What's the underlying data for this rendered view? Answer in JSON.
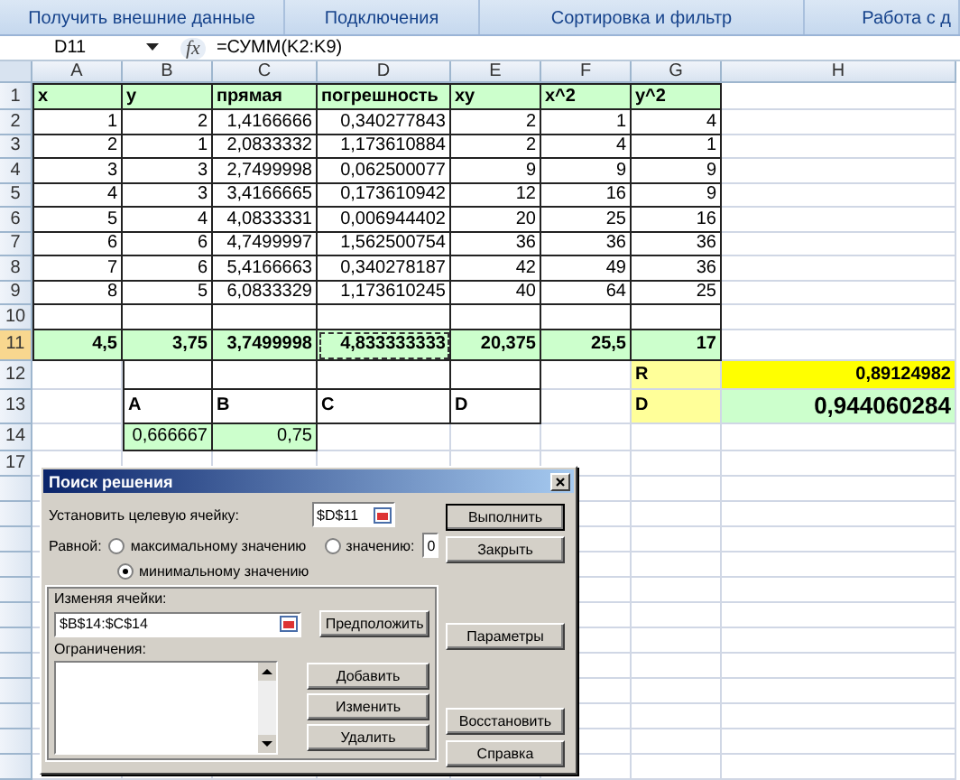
{
  "ribbon_groups": [
    "Получить внешние данные",
    "Подключения",
    "Сортировка и фильтр",
    "Работа с д"
  ],
  "formula_bar": {
    "name_box": "D11",
    "fx_label": "fx",
    "formula": "=СУММ(K2:K9)"
  },
  "sheet": {
    "columns": [
      "A",
      "B",
      "C",
      "D",
      "E",
      "F",
      "G",
      "H"
    ],
    "rows": [
      {
        "number": "1",
        "kind": "header",
        "color": "#ccffcc",
        "cells": [
          "x",
          "y",
          "прямая",
          "погрешность",
          "xy",
          "x^2",
          "y^2",
          null
        ]
      },
      {
        "number": "2",
        "kind": "data",
        "cells": [
          "1",
          "2",
          "1,4166666",
          "0,340277843",
          "2",
          "1",
          "4",
          null
        ]
      },
      {
        "number": "3",
        "kind": "data",
        "cells": [
          "2",
          "1",
          "2,0833332",
          "1,173610884",
          "2",
          "4",
          "1",
          null
        ]
      },
      {
        "number": "4",
        "kind": "data",
        "cells": [
          "3",
          "3",
          "2,7499998",
          "0,062500077",
          "9",
          "9",
          "9",
          null
        ]
      },
      {
        "number": "5",
        "kind": "data",
        "cells": [
          "4",
          "3",
          "3,4166665",
          "0,173610942",
          "12",
          "16",
          "9",
          null
        ]
      },
      {
        "number": "6",
        "kind": "data",
        "cells": [
          "5",
          "4",
          "4,0833331",
          "0,006944402",
          "20",
          "25",
          "16",
          null
        ]
      },
      {
        "number": "7",
        "kind": "data",
        "cells": [
          "6",
          "6",
          "4,7499997",
          "1,562500754",
          "36",
          "36",
          "36",
          null
        ]
      },
      {
        "number": "8",
        "kind": "data",
        "cells": [
          "7",
          "6",
          "5,4166663",
          "0,340278187",
          "42",
          "49",
          "36",
          null
        ]
      },
      {
        "number": "9",
        "kind": "data",
        "cells": [
          "8",
          "5",
          "6,0833329",
          "1,173610245",
          "40",
          "64",
          "25",
          null
        ]
      },
      {
        "number": "10",
        "kind": "data",
        "cells": [
          null,
          null,
          null,
          null,
          null,
          null,
          null,
          null
        ]
      },
      {
        "number": "11",
        "kind": "total",
        "color": "#ccffcc",
        "cells": [
          "4,5",
          "3,75",
          "3,7499998",
          {
            "text": "4,833333333",
            "marquee": true
          },
          "20,375",
          "25,5",
          "17",
          null
        ]
      },
      {
        "number": "12",
        "kind": "result",
        "cells": [
          null,
          null,
          null,
          null,
          null,
          null,
          {
            "text": "R",
            "color": "#ffff99"
          },
          {
            "text": "0,89124982",
            "color": "#ffff00"
          }
        ]
      },
      {
        "number": "13",
        "kind": "labels",
        "cells": [
          null,
          "A",
          "B",
          "C",
          "D",
          null,
          {
            "text": "D",
            "color": "#ffff99"
          },
          {
            "text": "0,944060284",
            "color": "#ccffcc",
            "large": true
          }
        ]
      },
      {
        "number": "14",
        "kind": "values",
        "color": "#ccffcc",
        "cells": [
          null,
          "0,666667",
          "0,75",
          null,
          null,
          null,
          null,
          null
        ]
      },
      {
        "number": "17",
        "kind": "blank",
        "cells": [
          null,
          null,
          null,
          null,
          null,
          null,
          null,
          null
        ]
      }
    ]
  },
  "dialog": {
    "title": "Поиск решения",
    "target": {
      "label": "Установить целевую ячейку:",
      "value": "$D$11"
    },
    "equal_label": "Равной:",
    "options": [
      {
        "label": "максимальному значению",
        "selected": false
      },
      {
        "label": "значению:",
        "selected": false
      },
      {
        "label": "минимальному значению",
        "selected": true
      }
    ],
    "value_field": "0",
    "changing": {
      "label": "Изменяя ячейки:",
      "value": "$B$14:$C$14",
      "button": "Предположить"
    },
    "constraints": {
      "label": "Ограничения:",
      "buttons": [
        "Добавить",
        "Изменить",
        "Удалить"
      ]
    },
    "side_buttons": [
      "Выполнить",
      "Закрыть",
      "Параметры",
      "Восстановить",
      "Справка"
    ]
  }
}
